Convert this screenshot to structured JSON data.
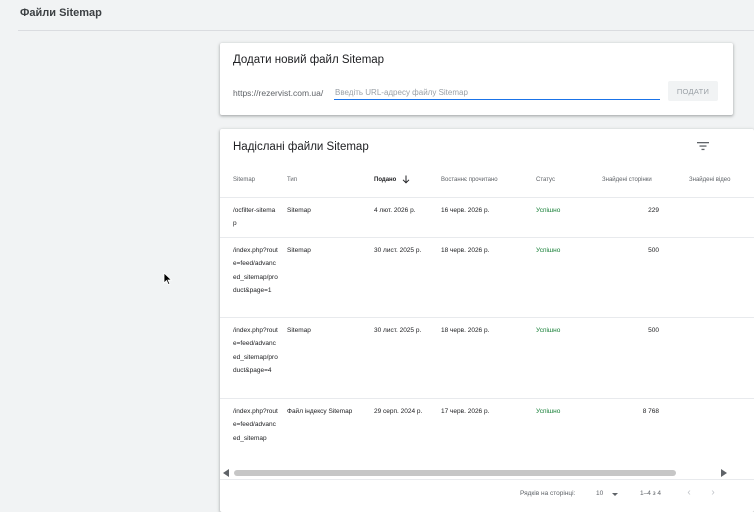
{
  "page": {
    "title": "Файли Sitemap"
  },
  "add_card": {
    "title": "Додати новий файл Sitemap",
    "url_prefix": "https://rezervist.com.ua/",
    "input_placeholder": "Введіть URL-адресу файлу Sitemap",
    "input_value": "",
    "submit_label": "ПОДАТИ"
  },
  "list_card": {
    "title": "Надіслані файли Sitemap",
    "filter_icon": "filter-icon",
    "columns": {
      "sitemap": "Sitemap",
      "type": "Тип",
      "submitted": "Подано",
      "last_read": "Востаннє прочитано",
      "status": "Статус",
      "pages": "Знайдені сторінки",
      "videos": "Знайдені відео"
    },
    "sorted_column": "submitted",
    "sort_direction": "descending",
    "rows": [
      {
        "sitemap": "/ocfilter-sitemap",
        "type": "Sitemap",
        "submitted": "4 лют. 2026 р.",
        "last_read": "16 черв. 2026 р.",
        "status": "Успішно",
        "pages": "229"
      },
      {
        "sitemap": "/index.php?route=feed/advanced_sitemap/product&page=1",
        "type": "Sitemap",
        "submitted": "30 лист. 2025 р.",
        "last_read": "18 черв. 2026 р.",
        "status": "Успішно",
        "pages": "500"
      },
      {
        "sitemap": "/index.php?route=feed/advanced_sitemap/product&page=4",
        "type": "Sitemap",
        "submitted": "30 лист. 2025 р.",
        "last_read": "18 черв. 2026 р.",
        "status": "Успішно",
        "pages": "500"
      },
      {
        "sitemap": "/index.php?route=feed/advanced_sitemap",
        "type": "Файл індексу Sitemap",
        "submitted": "29 серп. 2024 р.",
        "last_read": "17 черв. 2026 р.",
        "status": "Успішно",
        "pages": "8 768"
      }
    ],
    "pagination": {
      "rows_per_page_label": "Рядків на сторінці:",
      "rows_per_page": "10",
      "range": "1–4 з 4"
    }
  },
  "colors": {
    "accent": "#1a73e8",
    "success": "#188038",
    "background": "#f1f3f4"
  }
}
